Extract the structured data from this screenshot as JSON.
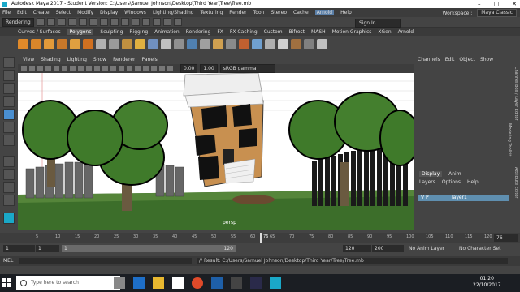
{
  "window": {
    "title": "Autodesk Maya 2017 - Student Version: C:\\Users\\Samuel Johnson\\Desktop\\Third Year\\Tree\\Tree.mb",
    "controls": [
      "–",
      "□",
      "✕"
    ]
  },
  "menubar": {
    "items": [
      "File",
      "Edit",
      "Create",
      "Select",
      "Modify",
      "Display",
      "Windows",
      "Lighting/Shading",
      "Texturing",
      "Render",
      "Toon",
      "Stereo",
      "Cache",
      "Arnold",
      "Help"
    ],
    "highlighted": "Arnold",
    "workspace_label": "Workspace :",
    "workspace_value": "Maya Classic"
  },
  "statusline": {
    "menuset": "Rendering",
    "sign_in": "Sign In"
  },
  "shelf": {
    "tabs": [
      "Curves / Surfaces",
      "Polygons",
      "Sculpting",
      "Rigging",
      "Animation",
      "Rendering",
      "FX",
      "FX Caching",
      "Custom",
      "Bifrost",
      "MASH",
      "Motion Graphics",
      "XGen",
      "Arnold"
    ],
    "active_tab": "Polygons",
    "icon_colors": [
      "#e08a2a",
      "#d9862a",
      "#e29a3a",
      "#c8782a",
      "#e0a040",
      "#d07020",
      "#b0b0b0",
      "#9a9a9a",
      "#c09040",
      "#e0b040",
      "#7090c0",
      "#c0c0c0",
      "#909090",
      "#5080b0",
      "#a0a0a0",
      "#d0a050",
      "#8a8a8a",
      "#c06030",
      "#70a0d0",
      "#b0b0b0",
      "#d0d0d0",
      "#a07040",
      "#808080",
      "#c0c0c0"
    ]
  },
  "viewport": {
    "menu": [
      "View",
      "Shading",
      "Lighting",
      "Show",
      "Renderer",
      "Panels"
    ],
    "color_space": "sRGB gamma",
    "field_value_1": "0.00",
    "field_value_2": "1.00",
    "camera_label": "persp"
  },
  "channelbox": {
    "menu": [
      "Channels",
      "Edit",
      "Object",
      "Show"
    ],
    "side_tabs": [
      "Channel Box / Layer Editor",
      "Modeling Toolkit",
      "Attribute Editor"
    ]
  },
  "layer_editor": {
    "tabs": [
      "Display",
      "Anim"
    ],
    "active_tab": "Display",
    "menu": [
      "Layers",
      "Options",
      "Help"
    ],
    "layer_name": "layer1",
    "layer_flags": "V P"
  },
  "timeline": {
    "ticks": [
      "5",
      "10",
      "15",
      "20",
      "25",
      "30",
      "35",
      "40",
      "45",
      "50",
      "55",
      "60",
      "65",
      "70",
      "75",
      "80",
      "85",
      "90",
      "95",
      "100",
      "105",
      "110",
      "115",
      "120"
    ],
    "current_frame": "76",
    "current_frame_field": "76"
  },
  "range": {
    "start": "1",
    "playback_start": "1",
    "range_slider_start": "1",
    "range_slider_end": "120",
    "playback_end": "120",
    "end": "200",
    "anim_layer": "No Anim Layer",
    "character_set": "No Character Set"
  },
  "commandline": {
    "mel_label": "MEL",
    "result": "// Result: C:/Users/Samuel Johnson/Desktop/Third Year/Tree/Tree.mb"
  },
  "taskbar": {
    "search_placeholder": "Type here to search",
    "time": "01:20",
    "date": "22/10/2017"
  }
}
